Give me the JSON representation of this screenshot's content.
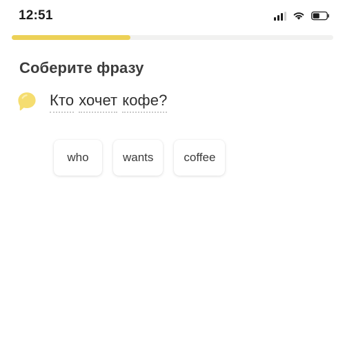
{
  "status_bar": {
    "time": "12:51",
    "signal_icon": "signal-bars-icon",
    "signal_bars_total": 4,
    "signal_bars_filled": 3,
    "wifi_icon": "wifi-icon",
    "battery_icon": "battery-icon",
    "battery_level_percent": 45
  },
  "progress": {
    "percent": 37,
    "fill_color": "#ecd157",
    "track_color": "#f1f1f0"
  },
  "screen": {
    "title": "Соберите фразу",
    "background_color": "#ffffff"
  },
  "prompt": {
    "bubble_icon": "speech-bubble-icon",
    "bubble_color": "#f5dd70",
    "sentence_words": [
      "Кто",
      "хочет",
      "кофе?"
    ],
    "sentence_full": "Кто хочет кофе?"
  },
  "answer_tiles": [
    {
      "label": "who"
    },
    {
      "label": "wants"
    },
    {
      "label": "coffee"
    }
  ]
}
